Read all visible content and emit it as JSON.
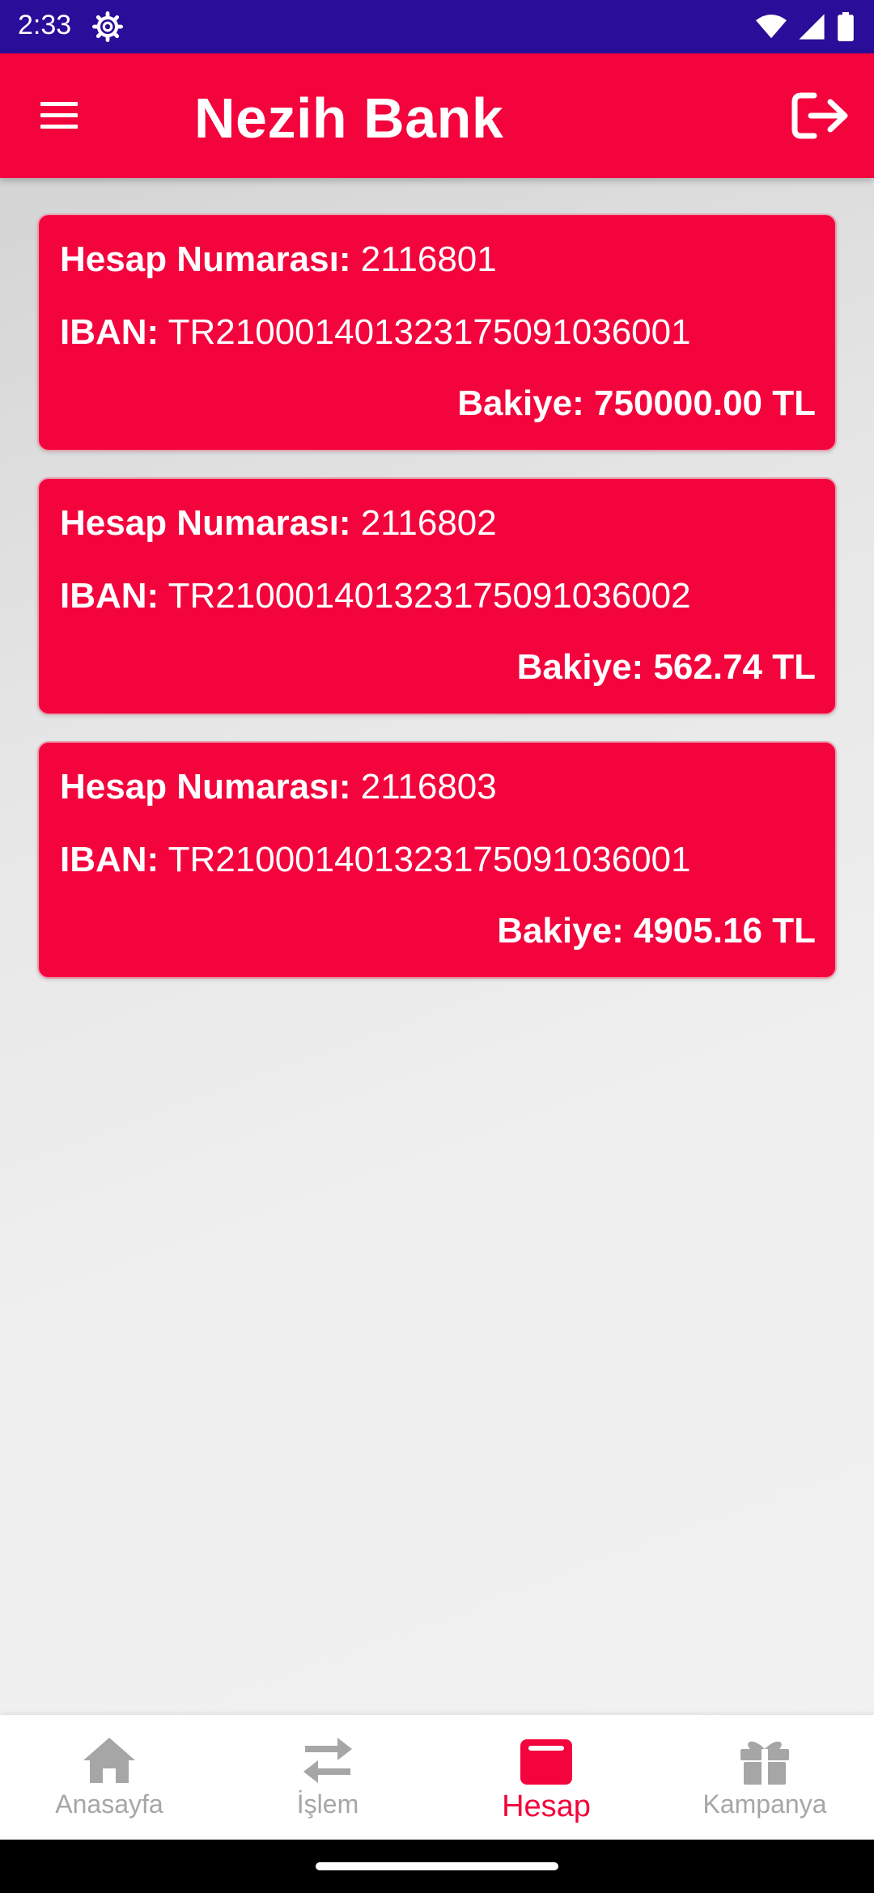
{
  "status_bar": {
    "time": "2:33"
  },
  "app_bar": {
    "title": "Nezih Bank"
  },
  "accounts": [
    {
      "number_label": "Hesap Numarası:",
      "number": "2116801",
      "iban_label": "IBAN:",
      "iban": "TR210001401323175091036001",
      "balance_label": "Bakiye:",
      "balance": "750000.00 TL"
    },
    {
      "number_label": "Hesap Numarası:",
      "number": "2116802",
      "iban_label": "IBAN:",
      "iban": "TR210001401323175091036002",
      "balance_label": "Bakiye:",
      "balance": "562.74 TL"
    },
    {
      "number_label": "Hesap Numarası:",
      "number": "2116803",
      "iban_label": "IBAN:",
      "iban": "TR210001401323175091036001",
      "balance_label": "Bakiye:",
      "balance": "4905.16 TL"
    }
  ],
  "bottom_nav": {
    "items": [
      {
        "label": "Anasayfa",
        "icon": "home-icon",
        "active": false
      },
      {
        "label": "İşlem",
        "icon": "transfer-icon",
        "active": false
      },
      {
        "label": "Hesap",
        "icon": "wallet-icon",
        "active": true
      },
      {
        "label": "Kampanya",
        "icon": "gift-icon",
        "active": false
      }
    ]
  },
  "colors": {
    "brand": "#f3043d",
    "status_bar": "#2a0d98",
    "nav_inactive": "#a6a6a6"
  }
}
